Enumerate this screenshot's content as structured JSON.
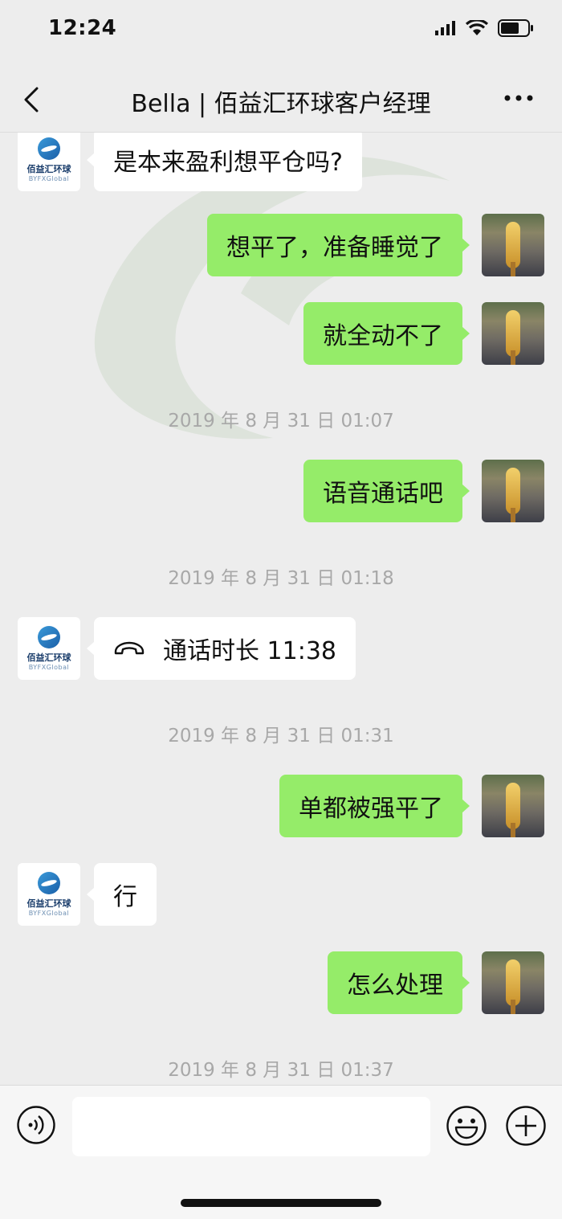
{
  "status_bar": {
    "time": "12:24"
  },
  "nav": {
    "title": "Bella | 佰益汇环球客户经理"
  },
  "contact_avatar": {
    "brand_cn": "佰益汇环球",
    "brand_en": "BYFXGlobal"
  },
  "messages": [
    {
      "dir": "in",
      "text": "是本来盈利想平仓吗?"
    },
    {
      "dir": "out",
      "text": "想平了，准备睡觉了"
    },
    {
      "dir": "out",
      "text": "就全动不了"
    },
    {
      "timestamp": "2019 年 8 月 31 日 01:07"
    },
    {
      "dir": "out",
      "text": "语音通话吧"
    },
    {
      "timestamp": "2019 年 8 月 31 日 01:18"
    },
    {
      "dir": "in",
      "type": "call",
      "text": "通话时长 11:38"
    },
    {
      "timestamp": "2019 年 8 月 31 日 01:31"
    },
    {
      "dir": "out",
      "text": "单都被强平了"
    },
    {
      "dir": "in",
      "text": "行"
    },
    {
      "dir": "out",
      "text": "怎么处理"
    },
    {
      "timestamp": "2019 年 8 月 31 日 01:37"
    }
  ],
  "input": {
    "value": ""
  },
  "colors": {
    "background": "#ededed",
    "outgoing_bubble": "#95ec69",
    "incoming_bubble": "#ffffff",
    "timestamp": "#a8a8a8"
  }
}
